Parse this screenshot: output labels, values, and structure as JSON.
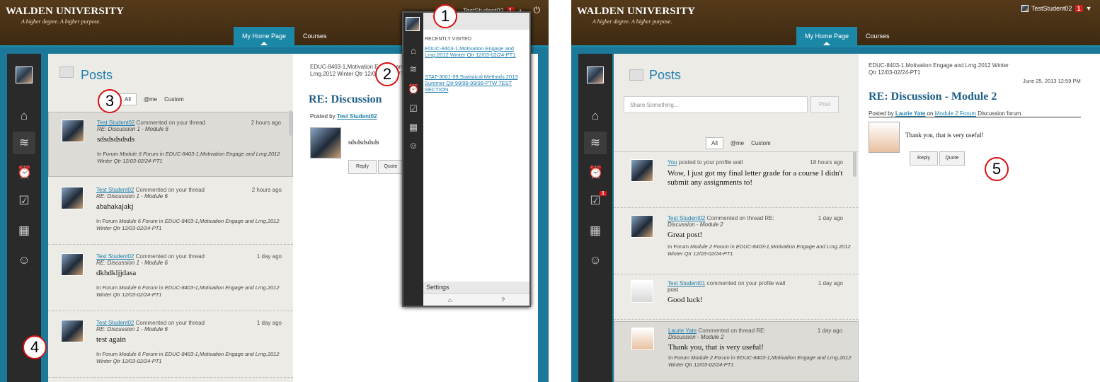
{
  "left": {
    "logo": {
      "title": "WALDEN UNIVERSITY",
      "tagline": "A higher degree. A higher purpose."
    },
    "user": {
      "name": "TestStudent02",
      "notif": "1"
    },
    "tabs": [
      {
        "label": "My Home Page"
      },
      {
        "label": "Courses"
      }
    ],
    "posts_title": "Posts",
    "filters": [
      "All",
      "@me",
      "Custom"
    ],
    "posts": [
      {
        "author": "Test Student02",
        "action": "Commented on your thread",
        "time": "2 hours ago",
        "subject": "RE: Discussion 1 - Module 6",
        "text": "sdsdsdsdsds",
        "forum": "Module 6 Forum",
        "course": "EDUC-8403-1,Motivation Engage and Lrng.2012 Winter Qtr 12/03-02/24-PT1"
      },
      {
        "author": "Test Student02",
        "action": "Commented on your thread",
        "time": "2 hours ago",
        "subject": "RE: Discussion 1 - Module 6",
        "text": "abahakajakj",
        "forum": "Module 6 Forum",
        "course": "EDUC-8403-1,Motivation Engage and Lrng.2012 Winter Qtr 12/03-02/24-PT1"
      },
      {
        "author": "Test Student02",
        "action": "Commented on your thread",
        "time": "1 day ago",
        "subject": "RE: Discussion 1 - Module 6",
        "text": "dkhdkljjdasa",
        "forum": "Module 6 Forum",
        "course": "EDUC-8403-1,Motivation Engage and Lrng.2012 Winter Qtr 12/03-02/24-PT1"
      },
      {
        "author": "Test Student02",
        "action": "Commented on your thread",
        "time": "1 day ago",
        "subject": "RE: Discussion 1 - Module 6",
        "text": "test again",
        "forum": "Module 6 Forum",
        "course": "EDUC-8403-1,Motivation Engage and Lrng.2012 Winter Qtr 12/03-02/24-PT1"
      }
    ],
    "in_forum": "In Forum",
    "in": "in",
    "reader": {
      "course": "EDUC-8403-1,Motivation Engage and Lrng.2012 Winter Qtr 12/03-02/24-PT1",
      "title": "RE: Discussion",
      "posted_by": "Posted by",
      "author": "Test Student02",
      "body": "sdsdsdsdsds",
      "reply": "Reply",
      "quote": "Quote"
    },
    "flyout": {
      "header": "RECENTLY VISITED",
      "links": [
        "EDUC-8403-1,Motivation Engage and Lrng.2012 Winter Qtr 12/03-02/24-PT1",
        "STAT-3001-99,Statistical Methods.2013 Summer Qtr 99/99-99/99-PTW TEST SECTION"
      ],
      "settings": "Settings",
      "help": "?"
    },
    "callouts": [
      "1",
      "2",
      "3",
      "4"
    ]
  },
  "right": {
    "logo": {
      "title": "WALDEN UNIVERSITY",
      "tagline": "A higher degree. A higher purpose."
    },
    "user": {
      "name": "TestStudent02",
      "notif": "1"
    },
    "tabs": [
      {
        "label": "My Home Page"
      },
      {
        "label": "Courses"
      }
    ],
    "posts_title": "Posts",
    "share_placeholder": "Share Something...",
    "post_button": "Post",
    "filters": [
      "All",
      "@me",
      "Custom"
    ],
    "posts": [
      {
        "author": "You",
        "action": "posted to your profile wall",
        "time": "18 hours ago",
        "text": "Wow, I just got my final letter grade for a course I didn't submit any assignments to!"
      },
      {
        "author": "Test Student02",
        "action": "Commented on thread RE:",
        "subject": "Discussion - Module 2",
        "time": "1 day ago",
        "text": "Great post!",
        "forum": "Module 2 Forum",
        "course": "EDUC-8403-1,Motivation Engage and Lrng.2012 Winter Qtr 12/03-02/24-PT1"
      },
      {
        "author": "Test Student01",
        "action": "commented on your profile wall",
        "subject": "post",
        "time": "1 day ago",
        "text": "Good luck!"
      },
      {
        "author": "Laurie Yate",
        "action": "Commented on thread RE:",
        "subject": "Discussion - Module 2",
        "time": "1 day ago",
        "text": "Thank you, that is very useful!",
        "forum": "Module 2 Forum",
        "course": "EDUC-8403-1,Motivation Engage and Lrng.2012 Winter Qtr 12/03-02/24-PT1"
      }
    ],
    "in_forum": "In Forum",
    "in": "in",
    "reader": {
      "course": "EDUC-8403-1,Motivation Engage and Lrng.2012 Winter Qtr 12/03-02/24-PT1",
      "date": "June 25, 2013 12:59 PM",
      "title": "RE: Discussion - Module 2",
      "posted_by": "Posted by",
      "author": "Laurie Yate",
      "on": "on",
      "forum": "Module 2 Forum",
      "forum_suffix": "Discussion forum.",
      "body": "Thank you, that is very useful!",
      "reply": "Reply",
      "quote": "Quote"
    },
    "rail_badge": "1",
    "callout": "5"
  },
  "colors": {
    "brown": "#4a3216",
    "teal": "#1c88a8",
    "link": "#1f7fae",
    "callout": "#d80f0f",
    "badge": "#d31c1c"
  }
}
